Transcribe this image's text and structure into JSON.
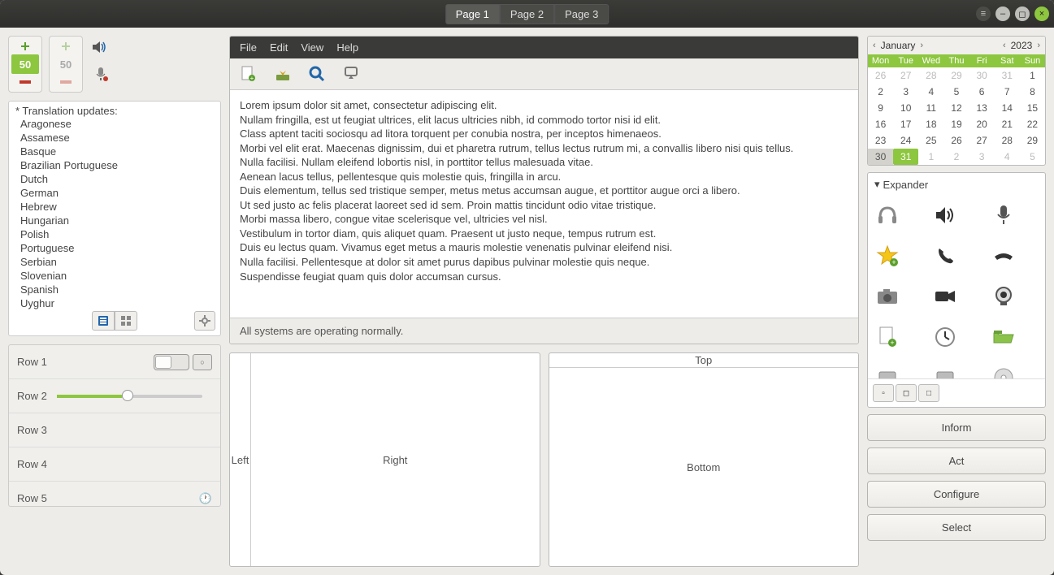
{
  "titlebar": {
    "tabs": [
      "Page 1",
      "Page 2",
      "Page 3"
    ],
    "active_tab": 0
  },
  "spinners": [
    {
      "value": "50",
      "active": true
    },
    {
      "value": "50",
      "active": false
    }
  ],
  "lang_panel": {
    "heading": "* Translation updates:",
    "languages": [
      "Aragonese",
      "Assamese",
      "Basque",
      "Brazilian Portuguese",
      "Dutch",
      "German",
      "Hebrew",
      "Hungarian",
      "Polish",
      "Portuguese",
      "Serbian",
      "Slovenian",
      "Spanish",
      "Uyghur"
    ]
  },
  "rows": [
    "Row 1",
    "Row 2",
    "Row 3",
    "Row 4",
    "Row 5"
  ],
  "editor": {
    "menu": [
      "File",
      "Edit",
      "View",
      "Help"
    ],
    "body": [
      "Lorem ipsum dolor sit amet, consectetur adipiscing elit.",
      "Nullam fringilla, est ut feugiat ultrices, elit lacus ultricies nibh, id commodo tortor nisi id elit.",
      "Class aptent taciti sociosqu ad litora torquent per conubia nostra, per inceptos himenaeos.",
      "Morbi vel elit erat. Maecenas dignissim, dui et pharetra rutrum, tellus lectus rutrum mi, a convallis libero nisi quis tellus.",
      "Nulla facilisi. Nullam eleifend lobortis nisl, in porttitor tellus malesuada vitae.",
      "Aenean lacus tellus, pellentesque quis molestie quis, fringilla in arcu.",
      "Duis elementum, tellus sed tristique semper, metus metus accumsan augue, et porttitor augue orci a libero.",
      "Ut sed justo ac felis placerat laoreet sed id sem. Proin mattis tincidunt odio vitae tristique.",
      "Morbi massa libero, congue vitae scelerisque vel, ultricies vel nisl.",
      "Vestibulum in tortor diam, quis aliquet quam. Praesent ut justo neque, tempus rutrum est.",
      "Duis eu lectus quam. Vivamus eget metus a mauris molestie venenatis pulvinar eleifend nisi.",
      "Nulla facilisi. Pellentesque at dolor sit amet purus dapibus pulvinar molestie quis neque.",
      "Suspendisse feugiat quam quis dolor accumsan cursus."
    ],
    "status": "All systems are operating normally."
  },
  "split_lr": {
    "left": "Left",
    "right": "Right"
  },
  "split_tb": {
    "top": "Top",
    "bottom": "Bottom"
  },
  "calendar": {
    "month": "January",
    "year": "2023",
    "weekdays": [
      "Mon",
      "Tue",
      "Wed",
      "Thu",
      "Fri",
      "Sat",
      "Sun"
    ],
    "rows": [
      [
        {
          "d": "26",
          "m": true
        },
        {
          "d": "27",
          "m": true
        },
        {
          "d": "28",
          "m": true
        },
        {
          "d": "29",
          "m": true
        },
        {
          "d": "30",
          "m": true
        },
        {
          "d": "31",
          "m": true
        },
        {
          "d": "1"
        }
      ],
      [
        {
          "d": "2"
        },
        {
          "d": "3"
        },
        {
          "d": "4"
        },
        {
          "d": "5"
        },
        {
          "d": "6"
        },
        {
          "d": "7"
        },
        {
          "d": "8"
        }
      ],
      [
        {
          "d": "9"
        },
        {
          "d": "10"
        },
        {
          "d": "11"
        },
        {
          "d": "12"
        },
        {
          "d": "13"
        },
        {
          "d": "14"
        },
        {
          "d": "15"
        }
      ],
      [
        {
          "d": "16"
        },
        {
          "d": "17"
        },
        {
          "d": "18"
        },
        {
          "d": "19"
        },
        {
          "d": "20"
        },
        {
          "d": "21"
        },
        {
          "d": "22"
        }
      ],
      [
        {
          "d": "23"
        },
        {
          "d": "24"
        },
        {
          "d": "25"
        },
        {
          "d": "26"
        },
        {
          "d": "27"
        },
        {
          "d": "28"
        },
        {
          "d": "29"
        }
      ],
      [
        {
          "d": "30",
          "s": true
        },
        {
          "d": "31",
          "t": true
        },
        {
          "d": "1",
          "m": true
        },
        {
          "d": "2",
          "m": true
        },
        {
          "d": "3",
          "m": true
        },
        {
          "d": "4",
          "m": true
        },
        {
          "d": "5",
          "m": true
        }
      ]
    ]
  },
  "expander": {
    "title": "Expander",
    "icons": [
      "headphones",
      "speaker",
      "microphone",
      "star-add",
      "phone-receiver",
      "phone-hangup",
      "camera",
      "video-camera",
      "webcam",
      "document-add",
      "clock",
      "folder-open",
      "hard-disk",
      "hard-disk",
      "optical-disc"
    ]
  },
  "action_buttons": [
    "Inform",
    "Act",
    "Configure",
    "Select"
  ]
}
